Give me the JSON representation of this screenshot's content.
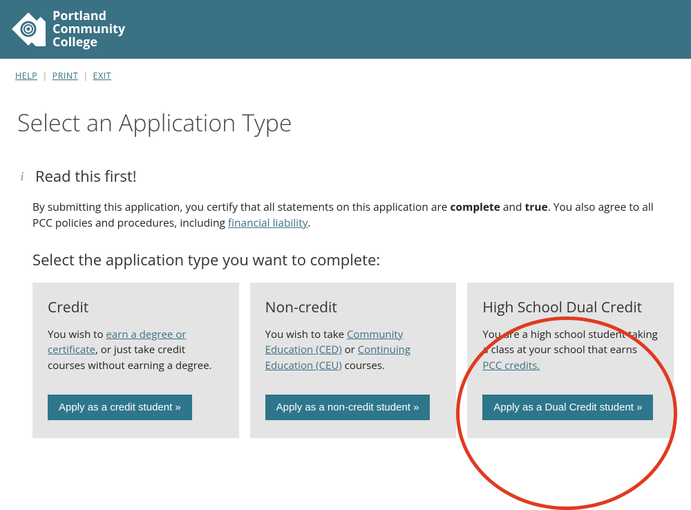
{
  "header": {
    "org_name_lines": [
      "Portland",
      "Community",
      "College"
    ]
  },
  "utility": {
    "help": "HELP",
    "print": "PRINT",
    "exit": "EXIT"
  },
  "page": {
    "title": "Select an Application Type",
    "read_first_heading": "Read this first!",
    "intro_prefix": "By submitting this application, you certify that all statements on this application are ",
    "intro_bold1": "complete",
    "intro_mid": " and ",
    "intro_bold2": "true",
    "intro_suffix1": ". You also agree to all PCC policies and procedures, including ",
    "intro_link": "financial liability",
    "intro_suffix2": ".",
    "select_subheading": "Select the application type you want to complete:"
  },
  "cards": [
    {
      "title": "Credit",
      "desc_parts": [
        "You wish to ",
        "earn a degree or certificate",
        ", or just take credit courses without earning a degree."
      ],
      "button": "Apply as a credit student »"
    },
    {
      "title": "Non-credit",
      "desc_parts": [
        "You wish to take ",
        "Community Education (CED)",
        " or ",
        "Continuing Education (CEU)",
        " courses."
      ],
      "button": "Apply as a non-credit student »"
    },
    {
      "title": "High School Dual Credit",
      "desc_parts": [
        "You are a high school student taking a class at your school that earns ",
        "PCC credits."
      ],
      "button": "Apply as a Dual Credit student »"
    }
  ],
  "annotation": {
    "circle_target": "card-dual-credit"
  }
}
